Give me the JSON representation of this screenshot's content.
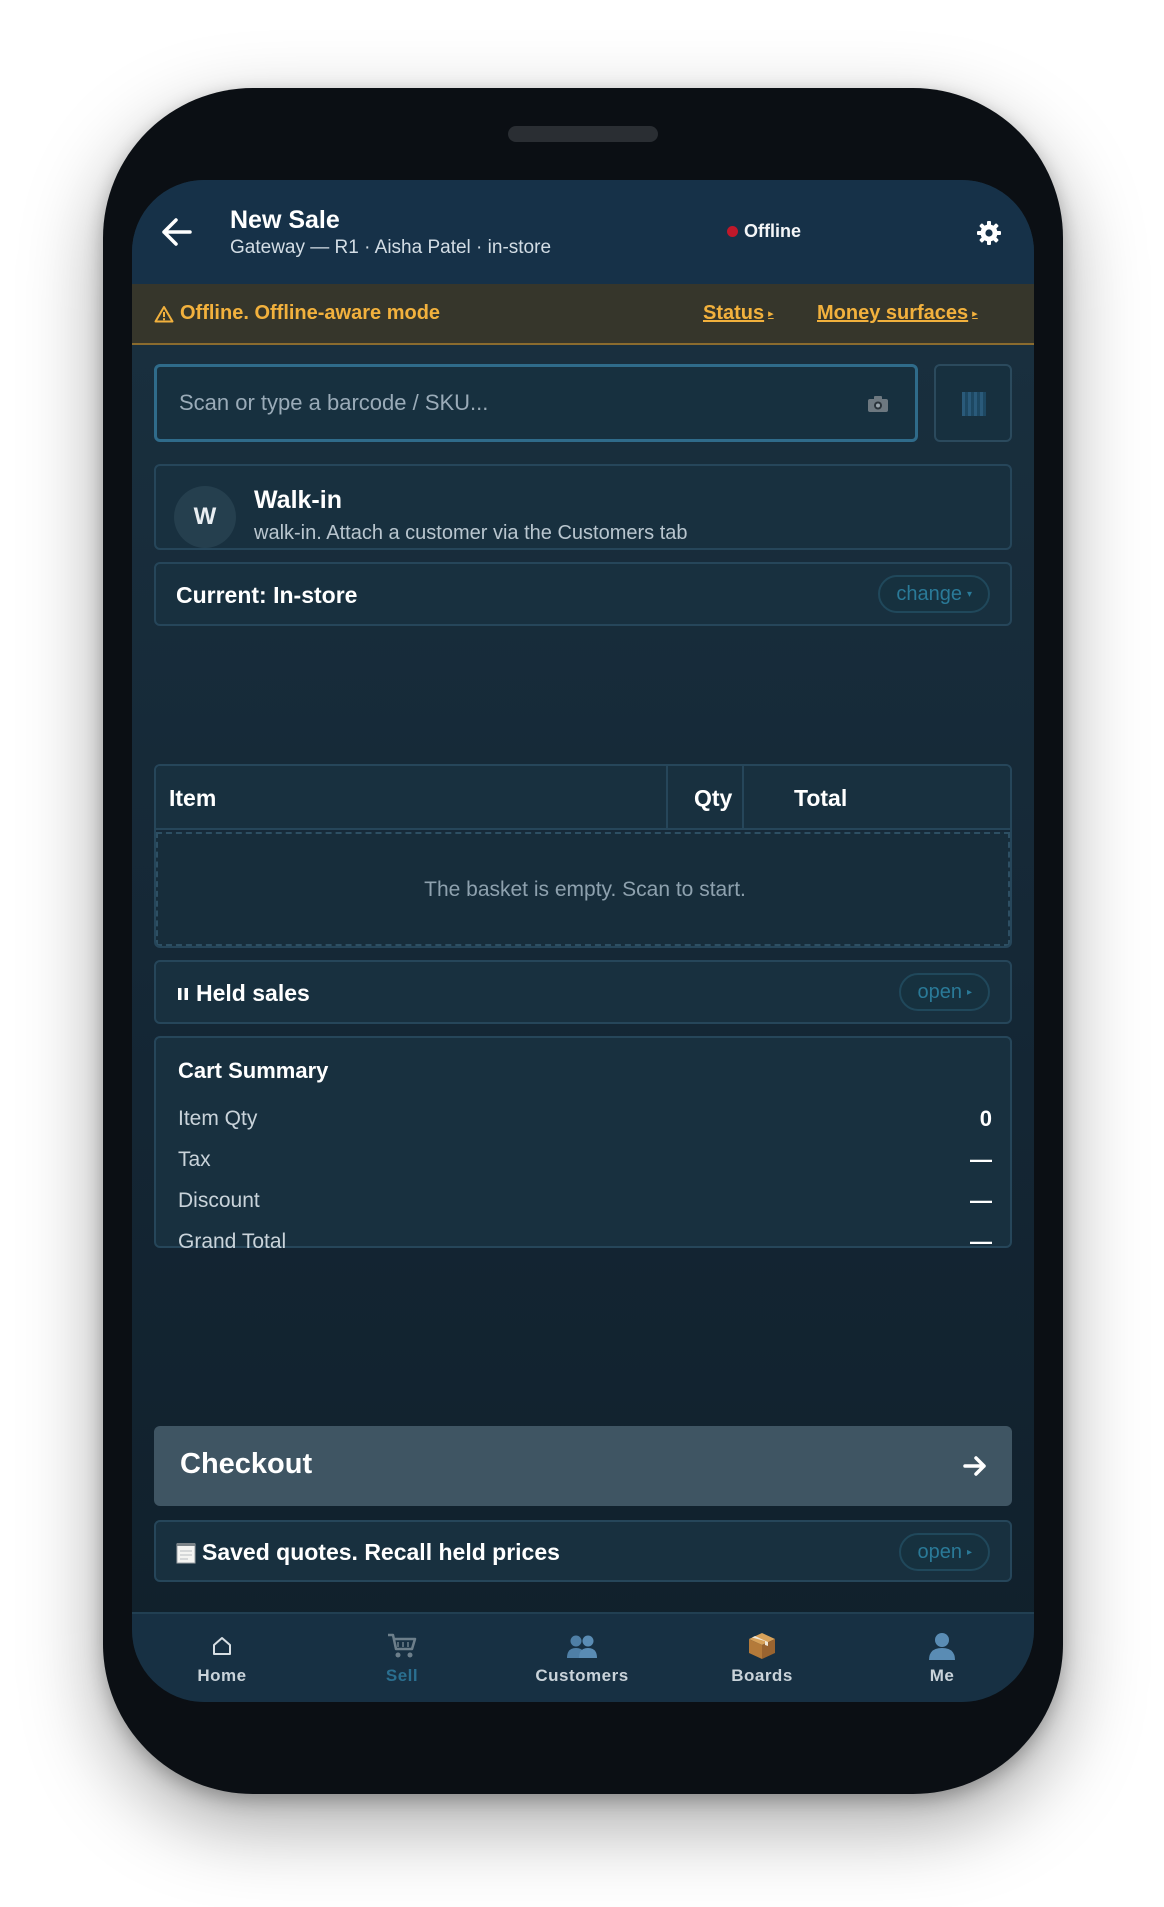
{
  "header": {
    "title": "New Sale",
    "subtitle": "Gateway — R1 · Aisha Patel · in-store",
    "status": "Offline"
  },
  "banner": {
    "text": "Offline. Offline-aware mode",
    "status_link": "Status",
    "money_link": "Money surfaces"
  },
  "scan": {
    "placeholder": "Scan or type a barcode / SKU..."
  },
  "customer": {
    "initial": "W",
    "name": "Walk-in",
    "subtitle": "walk-in. Attach a customer via the Customers tab"
  },
  "mode": {
    "label": "Current: In-store",
    "action": "change"
  },
  "basket": {
    "columns": [
      "Item",
      "Qty",
      "Total"
    ],
    "empty_text": "The basket is empty. Scan to start."
  },
  "held_sales": {
    "label": "Held sales",
    "action": "open"
  },
  "summary": {
    "title": "Cart Summary",
    "rows": [
      {
        "label": "Item Qty",
        "value": "0"
      },
      {
        "label": "Tax",
        "value": "—"
      },
      {
        "label": "Discount",
        "value": "—"
      },
      {
        "label": "Grand Total",
        "value": "—"
      }
    ]
  },
  "checkout": {
    "label": "Checkout"
  },
  "quotes": {
    "label": "Saved quotes. Recall held prices",
    "action": "open"
  },
  "nav": {
    "items": [
      {
        "label": "Home",
        "icon": "home-icon"
      },
      {
        "label": "Sell",
        "icon": "cart-icon",
        "active": true
      },
      {
        "label": "Customers",
        "icon": "people-icon"
      },
      {
        "label": "Boards",
        "icon": "box-icon"
      },
      {
        "label": "Me",
        "icon": "person-icon"
      }
    ]
  },
  "colors": {
    "header_bg": "#163148",
    "banner_text": "#f2b13d",
    "offline_dot": "#c0182a",
    "active_nav": "#2a6f90"
  }
}
